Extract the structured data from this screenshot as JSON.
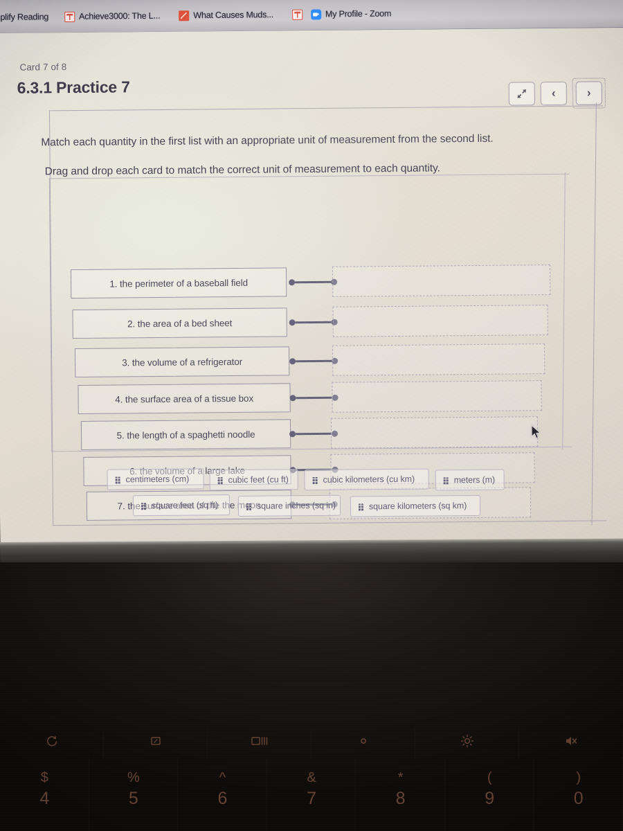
{
  "browser": {
    "tabs": [
      {
        "label": "mplify Reading",
        "favicon": "amplify-icon"
      },
      {
        "label": "Achieve3000: The L...",
        "favicon": "amplify-icon"
      },
      {
        "label": "What Causes Muds...",
        "favicon": "document-icon"
      },
      {
        "label": "My Profile - Zoom",
        "favicon": "zoom-camera-icon"
      }
    ]
  },
  "header": {
    "card_counter": "Card 7 of 8",
    "title": "6.3.1 Practice 7",
    "buttons": {
      "expand": "expand-icon",
      "previous": "‹",
      "next": "›"
    }
  },
  "instructions": {
    "line1": "Match each quantity in the first list with an appropriate unit of measurement from the second list.",
    "line2": "Drag and drop each card to match the correct unit of measurement to each quantity."
  },
  "quantities": [
    {
      "label": "1. the perimeter of a baseball field"
    },
    {
      "label": "2. the area of a bed sheet"
    },
    {
      "label": "3.  the volume of a refrigerator"
    },
    {
      "label": "4. the surface area of a tissue box"
    },
    {
      "label": "5. the length of a spaghetti noodle"
    },
    {
      "label": "6. the volume of a large lake"
    },
    {
      "label": "7. the surface area of the the moon"
    }
  ],
  "dropzones": [
    {
      "content": ""
    },
    {
      "content": ""
    },
    {
      "content": ""
    },
    {
      "content": ""
    },
    {
      "content": ""
    },
    {
      "content": ""
    },
    {
      "content": ""
    }
  ],
  "units": [
    {
      "label": "centimeters (cm)"
    },
    {
      "label": "cubic feet (cu ft)"
    },
    {
      "label": "cubic kilometers (cu km)"
    },
    {
      "label": "meters (m)"
    },
    {
      "label": "square feet (sq ft)"
    },
    {
      "label": "square inches (sq in)"
    },
    {
      "label": "square kilometers (sq km)"
    }
  ],
  "keyboard": {
    "function_keys": [
      {
        "icon": "refresh-icon"
      },
      {
        "icon": "fullscreen-icon"
      },
      {
        "icon": "window-overview-icon"
      },
      {
        "icon": "brightness-down-icon"
      },
      {
        "icon": "brightness-up-icon"
      },
      {
        "icon": "mute-icon"
      }
    ],
    "number_keys": [
      {
        "symbol": "$",
        "number": "4"
      },
      {
        "symbol": "%",
        "number": "5"
      },
      {
        "symbol": "^",
        "number": "6"
      },
      {
        "symbol": "&",
        "number": "7"
      },
      {
        "symbol": "*",
        "number": "8"
      },
      {
        "symbol": "(",
        "number": "9"
      },
      {
        "symbol": ")",
        "number": "0"
      }
    ]
  },
  "colors": {
    "page_background": "#e3ddd2",
    "text": "#3c3a4c",
    "border": "#8f8a9e",
    "connector": "#5b5870",
    "tabstrip": "#c3c1c6",
    "zoom_blue": "#2d8cff",
    "favicon_red": "#e0503c",
    "key_label": "#8c5b46"
  }
}
